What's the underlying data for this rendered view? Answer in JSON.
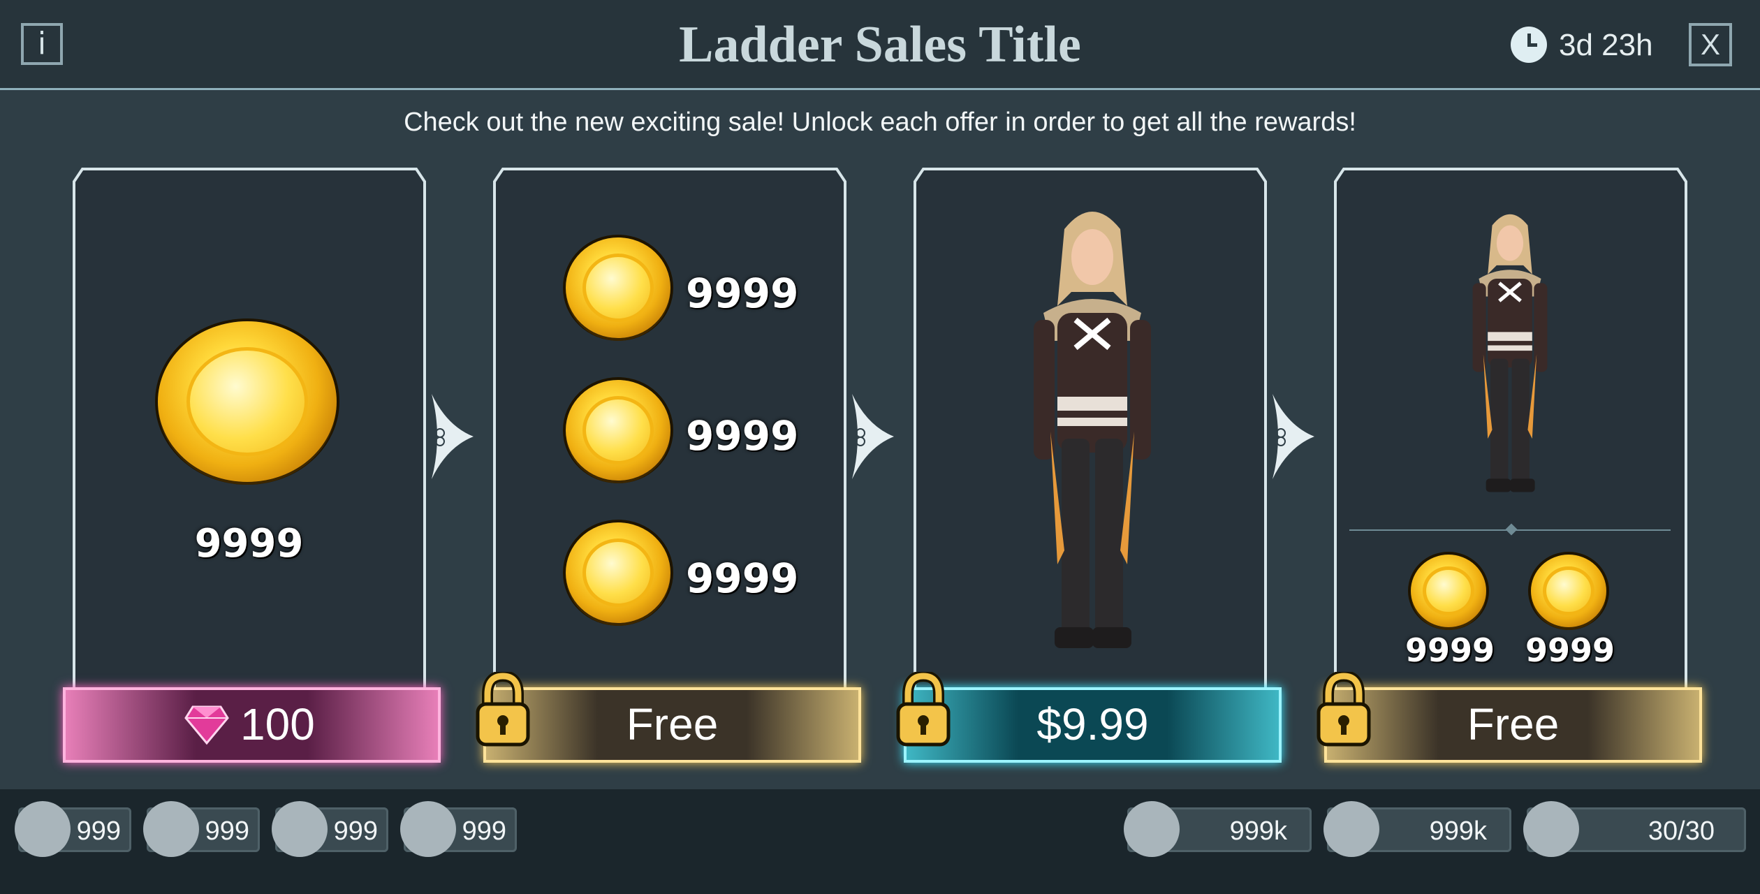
{
  "header": {
    "title": "Ladder Sales Title",
    "timer": "3d 23h",
    "info_label": "i",
    "close_label": "X"
  },
  "subtitle": "Check out the new exciting sale! Unlock each offer in order to get all the rewards!",
  "offers": [
    {
      "items": [
        {
          "type": "coin",
          "qty": "9999"
        }
      ],
      "price": "100",
      "currency": "gem",
      "locked": false,
      "price_color": "#e37db3"
    },
    {
      "items": [
        {
          "type": "coin",
          "qty": "9999"
        },
        {
          "type": "coin",
          "qty": "9999"
        },
        {
          "type": "coin",
          "qty": "9999"
        }
      ],
      "price": "Free",
      "locked": true,
      "price_color": "#c8a95a"
    },
    {
      "items": [
        {
          "type": "outfit"
        }
      ],
      "price": "$9.99",
      "locked": true,
      "price_color": "#1fa8b8"
    },
    {
      "items": [
        {
          "type": "outfit"
        },
        {
          "type": "coin",
          "qty": "9999"
        },
        {
          "type": "coin",
          "qty": "9999"
        }
      ],
      "price": "Free",
      "locked": true,
      "price_color": "#c8a95a"
    }
  ],
  "footer": {
    "left_resources": [
      "999",
      "999",
      "999",
      "999"
    ],
    "right_resources": [
      "999k",
      "999k",
      "30/30"
    ]
  },
  "colors": {
    "background": "#2f3e46",
    "header": "#27343b",
    "frame": "#d8e6ea",
    "footer": "#1b262c"
  }
}
